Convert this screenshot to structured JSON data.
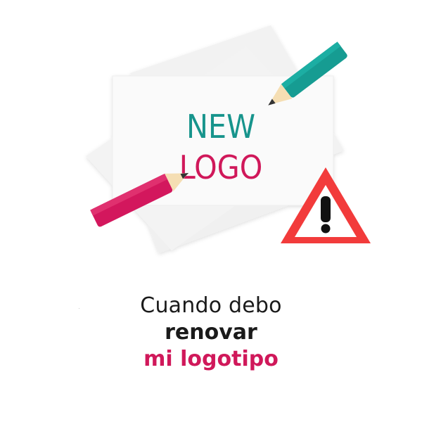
{
  "illustration": {
    "card_text_line1": "NEW",
    "card_text_line2": "LOGO",
    "warning_glyph": "!",
    "icons": [
      "paper-stack-icon",
      "teal-pencil-icon",
      "pink-pencil-icon",
      "warning-triangle-icon"
    ]
  },
  "caption": {
    "line1": "Cuando debo",
    "line2": "renovar",
    "line3": "mi logotipo"
  },
  "colors": {
    "teal": "#17948c",
    "magenta": "#d0185a",
    "warning_red": "#f23b3b",
    "text_dark": "#1a1a1a",
    "paper": "#f7f7f7"
  }
}
